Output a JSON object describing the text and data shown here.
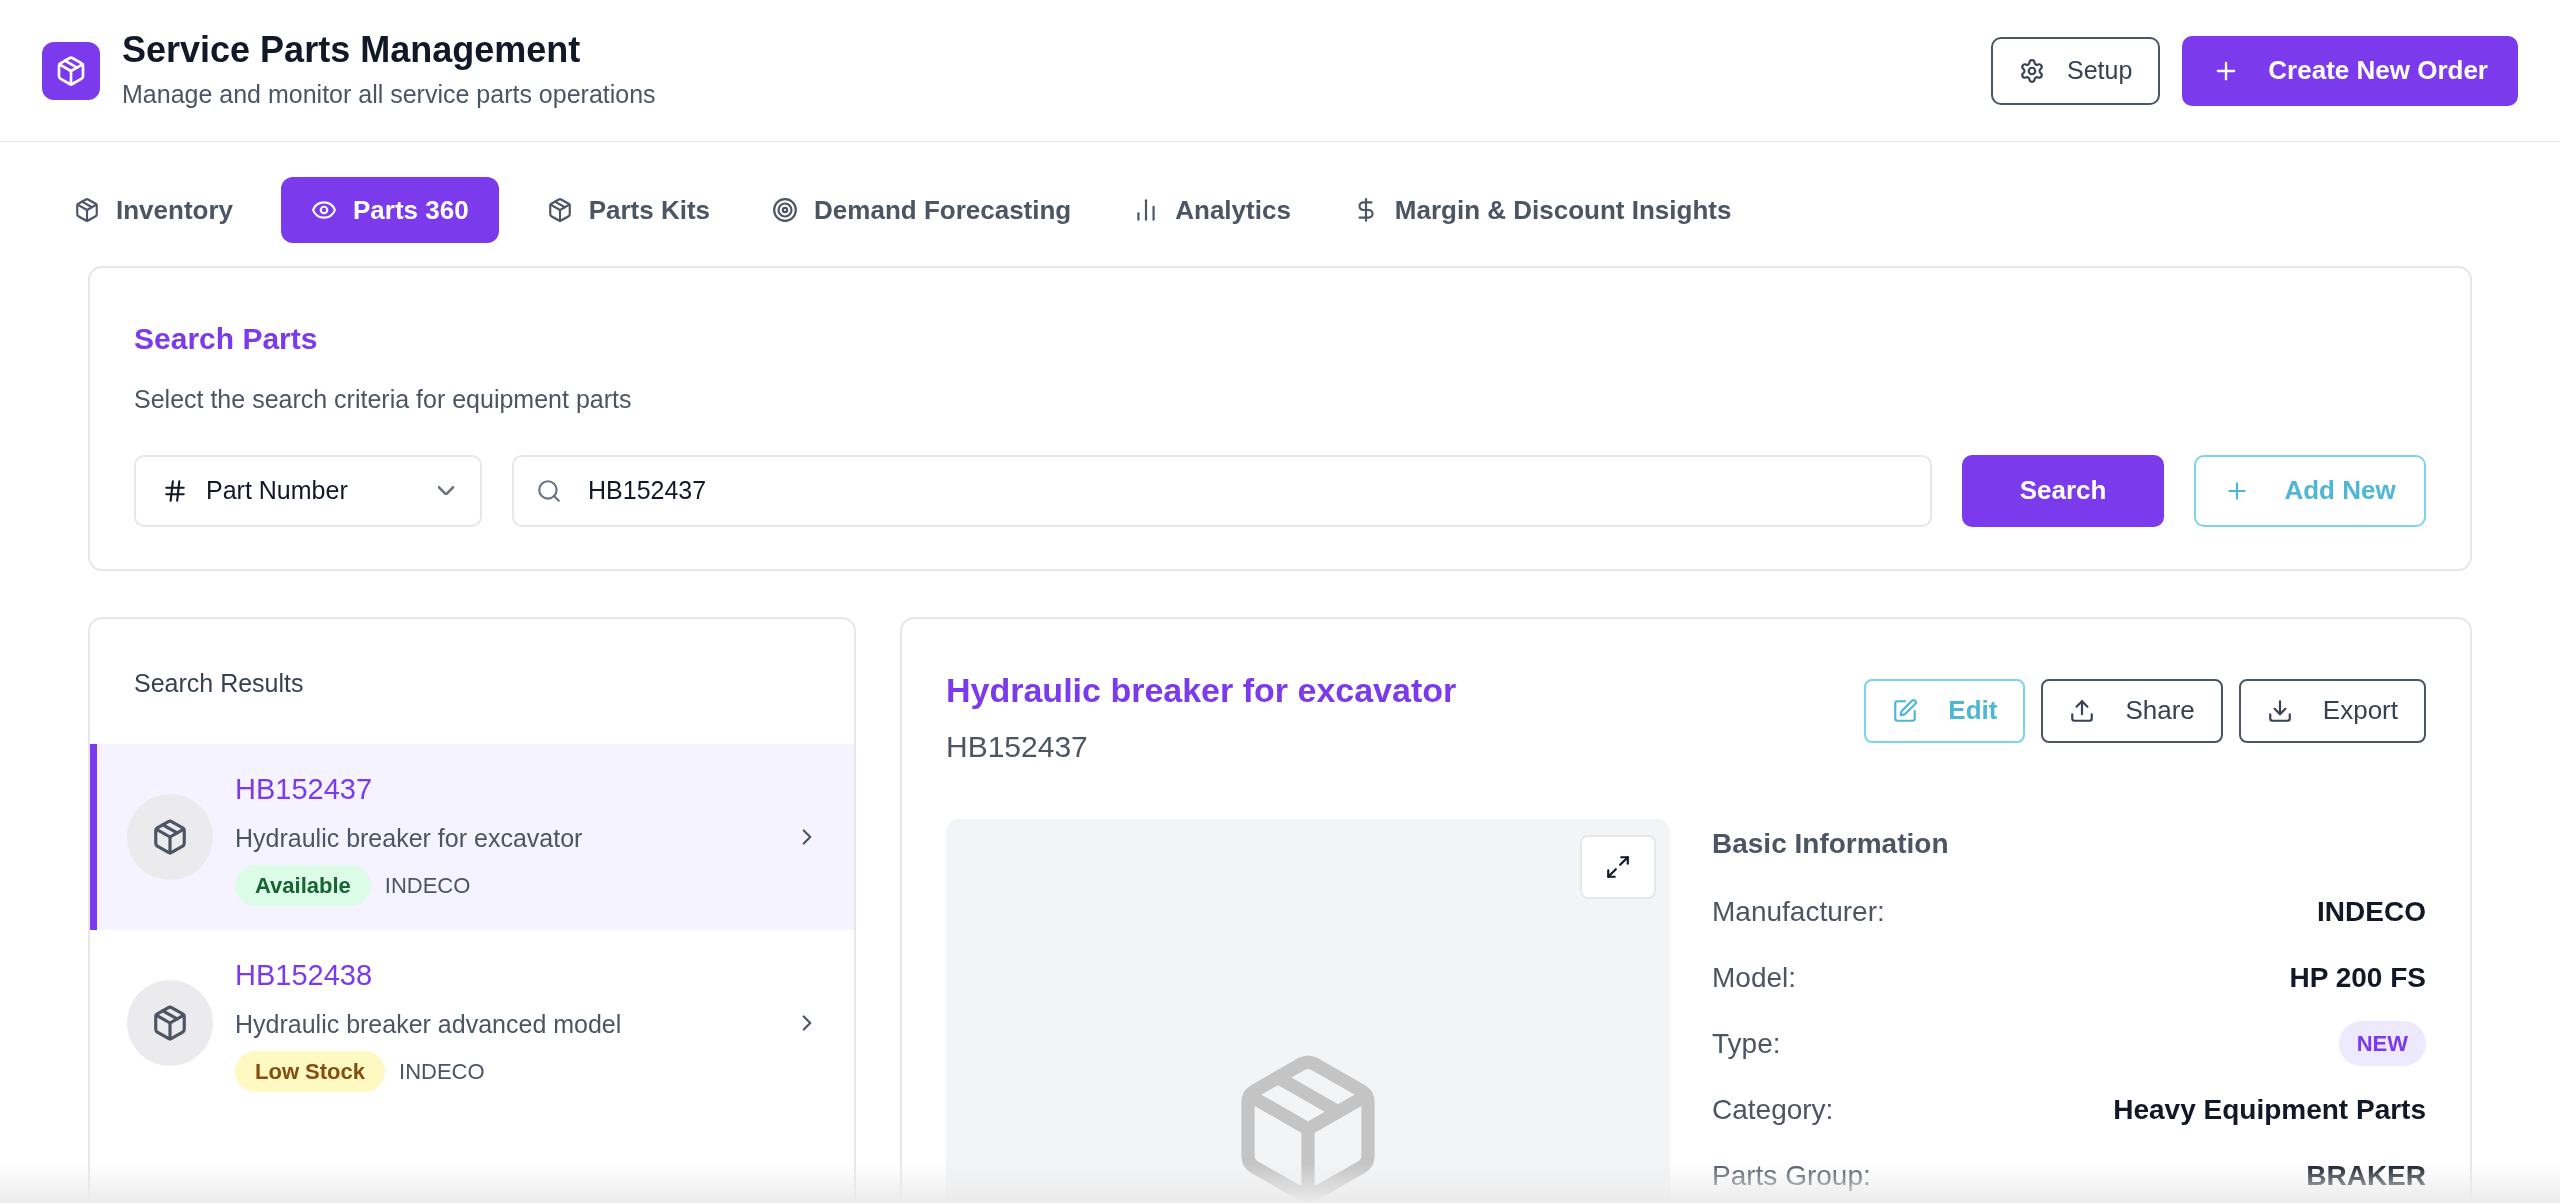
{
  "header": {
    "title": "Service Parts Management",
    "subtitle": "Manage and monitor all service parts operations",
    "setup_button": "Setup",
    "create_button": "Create New Order"
  },
  "tabs": [
    {
      "label": "Inventory",
      "selected": false
    },
    {
      "label": "Parts 360",
      "selected": true
    },
    {
      "label": "Parts Kits",
      "selected": false
    },
    {
      "label": "Demand Forecasting",
      "selected": false
    },
    {
      "label": "Analytics",
      "selected": false
    },
    {
      "label": "Margin & Discount Insights",
      "selected": false
    }
  ],
  "search": {
    "title": "Search Parts",
    "description": "Select the search criteria for equipment parts",
    "criteria": "Part Number",
    "query": "HB152437",
    "search_button": "Search",
    "add_button": "Add New"
  },
  "results": {
    "title": "Search Results",
    "items": [
      {
        "part_number": "HB152437",
        "description": "Hydraulic breaker for excavator",
        "status": "Available",
        "color": "#dcfce7",
        "manufacturer": "INDECO",
        "selected": true
      },
      {
        "part_number": "HB152438",
        "description": "Hydraulic breaker advanced model",
        "status": "Low Stock",
        "color": "#fef9c3",
        "manufacturer": "INDECO",
        "selected": false
      }
    ]
  },
  "detail": {
    "title": "Hydraulic breaker for excavator",
    "part_number": "HB152437",
    "actions": [
      {
        "label": "Edit",
        "kind": "accent"
      },
      {
        "label": "Share",
        "kind": "plain"
      },
      {
        "label": "Export",
        "kind": "plain"
      }
    ],
    "basic_info": {
      "title": "Basic Information",
      "fields": [
        {
          "label": "Manufacturer:",
          "value": "INDECO",
          "kind": "text"
        },
        {
          "label": "Model:",
          "value": "HP 200 FS",
          "kind": "text"
        },
        {
          "label": "Type:",
          "value": "NEW",
          "kind": "badge"
        },
        {
          "label": "Category:",
          "value": "Heavy Equipment Parts",
          "kind": "text"
        },
        {
          "label": "Parts Group:",
          "value": "BRAKER",
          "kind": "text"
        }
      ]
    }
  }
}
